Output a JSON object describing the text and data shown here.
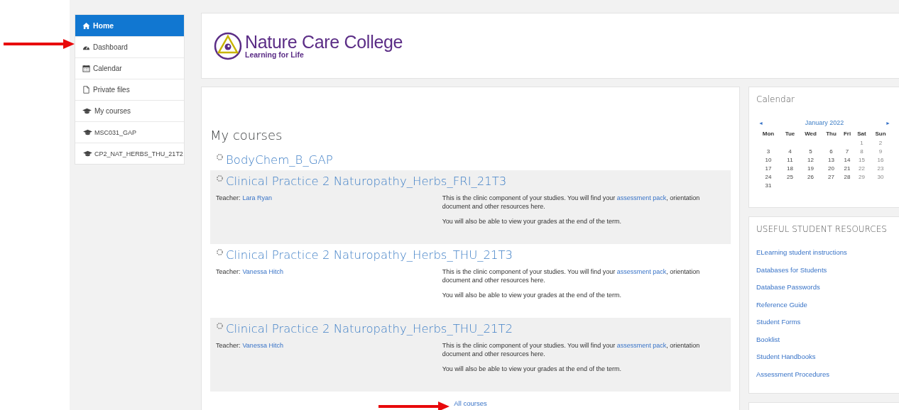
{
  "sidebar": {
    "items": [
      {
        "label": "Home",
        "selected": true
      },
      {
        "label": "Dashboard",
        "selected": false
      },
      {
        "label": "Calendar",
        "selected": false
      },
      {
        "label": "Private files",
        "selected": false
      },
      {
        "label": "My courses",
        "selected": false,
        "children": [
          {
            "label": "MSC031_GAP",
            "selected": false
          },
          {
            "label": "CP2_NAT_HERBS_THU_21T2",
            "selected": false
          }
        ]
      }
    ]
  },
  "header": {
    "logo": {
      "name": "Nature Care College",
      "tagline": "Learning for Life"
    }
  },
  "courses_block": {
    "title": "My courses",
    "courses": [
      {
        "kind": "link",
        "title": "BodyChem_B_GAP"
      },
      {
        "kind": "card",
        "title": "Clinical Practice 2 Naturopathy_Herbs_FRI_21T3",
        "teacher_label": "Teacher:",
        "teacher": "Lara Ryan",
        "summary": {
          "before": "This is the clinic component of your studies.  You will find your",
          "link": "assessment pack",
          "after": ", orientation document and other resources here."
        },
        "note": "You will also be able to view your grades at the end of the term."
      },
      {
        "kind": "card",
        "title": "Clinical Practice 2 Naturopathy_Herbs_THU_21T3",
        "teacher_label": "Teacher:",
        "teacher": "Vanessa Hitch",
        "summary": {
          "before": "This is the clinic component of your studies.  You will find your",
          "link": "assessment pack",
          "after": ", orientation document and other resources here."
        },
        "note": "You will also be able to view your grades at the end of the term."
      },
      {
        "kind": "card",
        "title": "Clinical Practice 2 Naturopathy_Herbs_THU_21T2",
        "teacher_label": "Teacher:",
        "teacher": "Vanessa Hitch",
        "summary": {
          "before": "This is the clinic component of your studies.  You will find your",
          "link": "assessment pack",
          "after": ", orientation document and other resources here."
        },
        "note": "You will also be able to view your grades at the end of the term."
      }
    ],
    "all_link": "All courses"
  },
  "calendar": {
    "title": "Calendar",
    "prev": "◄",
    "next": "►",
    "month": "January 2022",
    "weekdays": [
      "Mon",
      "Tue",
      "Wed",
      "Thu",
      "Fri",
      "Sat",
      "Sun"
    ],
    "weeks": [
      [
        "1",
        "2"
      ],
      [
        "3",
        "4",
        "5",
        "6",
        "7",
        "8",
        "9"
      ],
      [
        "10",
        "11",
        "12",
        "13",
        "14",
        "15",
        "16"
      ],
      [
        "17",
        "18",
        "19",
        "20",
        "21",
        "22",
        "23"
      ],
      [
        "24",
        "25",
        "26",
        "27",
        "28",
        "29",
        "30"
      ],
      [
        "31"
      ]
    ]
  },
  "resources": {
    "title": "USEFUL STUDENT RESOURCES",
    "links": [
      "ELearning student instructions",
      "Databases for Students",
      "Database Passwords",
      "Reference Guide",
      "Student Forms",
      "Booklist",
      "Student Handbooks",
      "Assessment Procedures"
    ]
  },
  "annotations": [
    {
      "kind": "arrow"
    },
    {
      "kind": "arrow"
    }
  ]
}
